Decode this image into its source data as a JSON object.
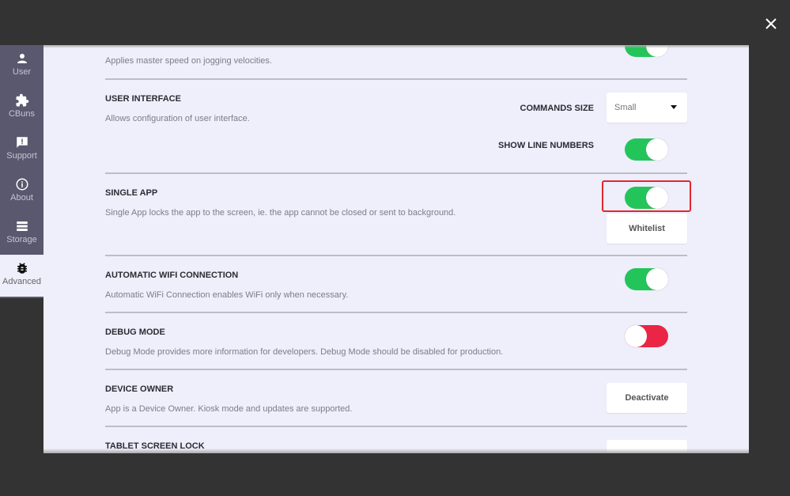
{
  "close_icon": "close-icon",
  "sidebar": {
    "items": [
      {
        "label": "User",
        "icon": "user-icon",
        "active": false
      },
      {
        "label": "CBuns",
        "icon": "puzzle-icon",
        "active": false
      },
      {
        "label": "Support",
        "icon": "feedback-icon",
        "active": false
      },
      {
        "label": "About",
        "icon": "info-icon",
        "active": false
      },
      {
        "label": "Storage",
        "icon": "storage-icon",
        "active": false
      },
      {
        "label": "Advanced",
        "icon": "bug-icon",
        "active": true
      }
    ]
  },
  "colors": {
    "toggle_on": "#23c55a",
    "toggle_off": "#ea2545",
    "highlight": "#e0282e",
    "panel_bg": "#efeefb",
    "sidebar_bg": "#5a586e"
  },
  "settings": {
    "jog": {
      "desc": "Applies master speed on jogging velocities.",
      "enabled": true
    },
    "user_interface": {
      "title": "USER INTERFACE",
      "desc": "Allows configuration of user interface.",
      "commands_size_label": "COMMANDS SIZE",
      "commands_size_value": "Small",
      "show_line_numbers_label": "SHOW LINE NUMBERS",
      "show_line_numbers": true
    },
    "single_app": {
      "title": "SINGLE APP",
      "desc": "Single App locks the app to the screen, ie. the app cannot be closed or sent to background.",
      "enabled": true,
      "whitelist_label": "Whitelist"
    },
    "wifi": {
      "title": "AUTOMATIC WIFI CONNECTION",
      "desc": "Automatic WiFi Connection enables WiFi only when necessary.",
      "enabled": true
    },
    "debug": {
      "title": "DEBUG MODE",
      "desc": "Debug Mode provides more information for developers. Debug Mode should be disabled for production.",
      "enabled": false
    },
    "device_owner": {
      "title": "DEVICE OWNER",
      "desc": "App is a Device Owner. Kiosk mode and updates are supported.",
      "button_label": "Deactivate"
    },
    "tablet_lock": {
      "title": "TABLET SCREEN LOCK"
    }
  }
}
